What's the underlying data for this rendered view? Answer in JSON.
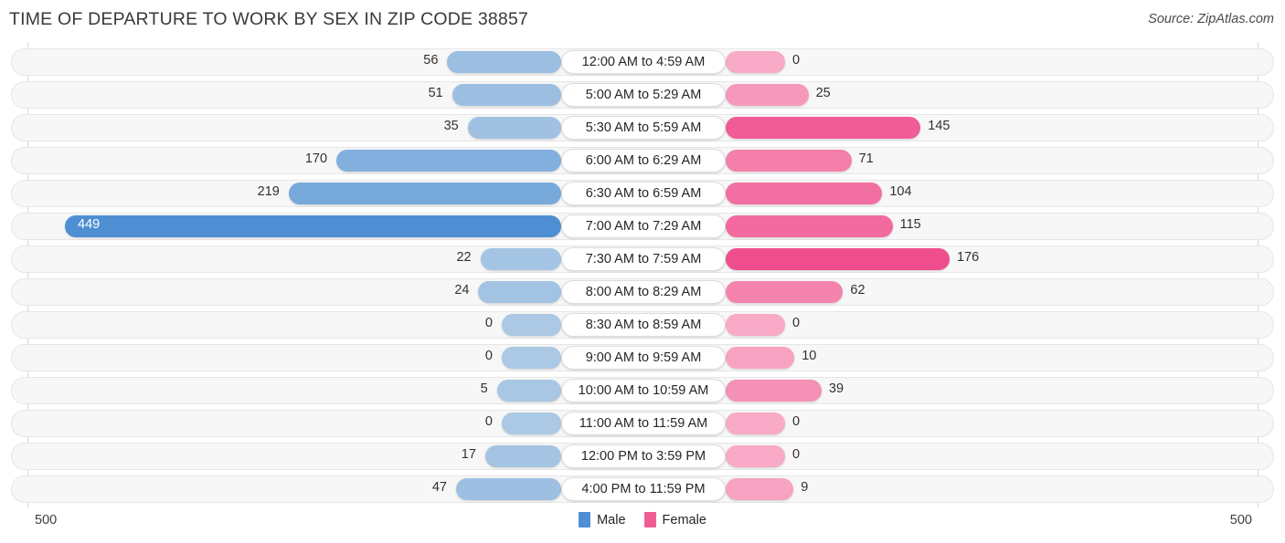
{
  "header": {
    "title": "TIME OF DEPARTURE TO WORK BY SEX IN ZIP CODE 38857",
    "source": "Source: ZipAtlas.com"
  },
  "legend": {
    "male_label": "Male",
    "female_label": "Female",
    "male_color": "#4e8fd4",
    "female_color": "#ef5e92"
  },
  "axis": {
    "left_tick": "500",
    "right_tick": "500",
    "max": 500
  },
  "chart_data": {
    "type": "bar",
    "title": "TIME OF DEPARTURE TO WORK BY SEX IN ZIP CODE 38857",
    "subtitle": "",
    "xlabel": "",
    "ylabel": "",
    "orientation": "horizontal-diverging",
    "xlim": [
      500,
      500
    ],
    "grid": false,
    "legend_position": "bottom-center",
    "categories": [
      "12:00 AM to 4:59 AM",
      "5:00 AM to 5:29 AM",
      "5:30 AM to 5:59 AM",
      "6:00 AM to 6:29 AM",
      "6:30 AM to 6:59 AM",
      "7:00 AM to 7:29 AM",
      "7:30 AM to 7:59 AM",
      "8:00 AM to 8:29 AM",
      "8:30 AM to 8:59 AM",
      "9:00 AM to 9:59 AM",
      "10:00 AM to 10:59 AM",
      "11:00 AM to 11:59 AM",
      "12:00 PM to 3:59 PM",
      "4:00 PM to 11:59 PM"
    ],
    "series": [
      {
        "name": "Male",
        "side": "left",
        "color": "#8ab7e3",
        "values": [
          56,
          51,
          35,
          170,
          219,
          449,
          22,
          24,
          0,
          0,
          5,
          0,
          17,
          47
        ]
      },
      {
        "name": "Female",
        "side": "right",
        "color": "#f7a8c4",
        "values": [
          0,
          25,
          145,
          71,
          104,
          115,
          176,
          62,
          0,
          10,
          39,
          0,
          0,
          9
        ]
      }
    ]
  },
  "rows": [
    {
      "category": "12:00 AM to 4:59 AM",
      "male": "56",
      "female": "0",
      "male_val": 56,
      "female_val": 0
    },
    {
      "category": "5:00 AM to 5:29 AM",
      "male": "51",
      "female": "25",
      "male_val": 51,
      "female_val": 25
    },
    {
      "category": "5:30 AM to 5:59 AM",
      "male": "35",
      "female": "145",
      "male_val": 35,
      "female_val": 145
    },
    {
      "category": "6:00 AM to 6:29 AM",
      "male": "170",
      "female": "71",
      "male_val": 170,
      "female_val": 71
    },
    {
      "category": "6:30 AM to 6:59 AM",
      "male": "219",
      "female": "104",
      "male_val": 219,
      "female_val": 104
    },
    {
      "category": "7:00 AM to 7:29 AM",
      "male": "449",
      "female": "115",
      "male_val": 449,
      "female_val": 115
    },
    {
      "category": "7:30 AM to 7:59 AM",
      "male": "22",
      "female": "176",
      "male_val": 22,
      "female_val": 176
    },
    {
      "category": "8:00 AM to 8:29 AM",
      "male": "24",
      "female": "62",
      "male_val": 24,
      "female_val": 62
    },
    {
      "category": "8:30 AM to 8:59 AM",
      "male": "0",
      "female": "0",
      "male_val": 0,
      "female_val": 0
    },
    {
      "category": "9:00 AM to 9:59 AM",
      "male": "0",
      "female": "10",
      "male_val": 0,
      "female_val": 10
    },
    {
      "category": "10:00 AM to 10:59 AM",
      "male": "5",
      "female": "39",
      "male_val": 5,
      "female_val": 39
    },
    {
      "category": "11:00 AM to 11:59 AM",
      "male": "0",
      "female": "0",
      "male_val": 0,
      "female_val": 0
    },
    {
      "category": "12:00 PM to 3:59 PM",
      "male": "17",
      "female": "0",
      "male_val": 17,
      "female_val": 0
    },
    {
      "category": "4:00 PM to 11:59 PM",
      "male": "47",
      "female": "9",
      "male_val": 47,
      "female_val": 9
    }
  ]
}
